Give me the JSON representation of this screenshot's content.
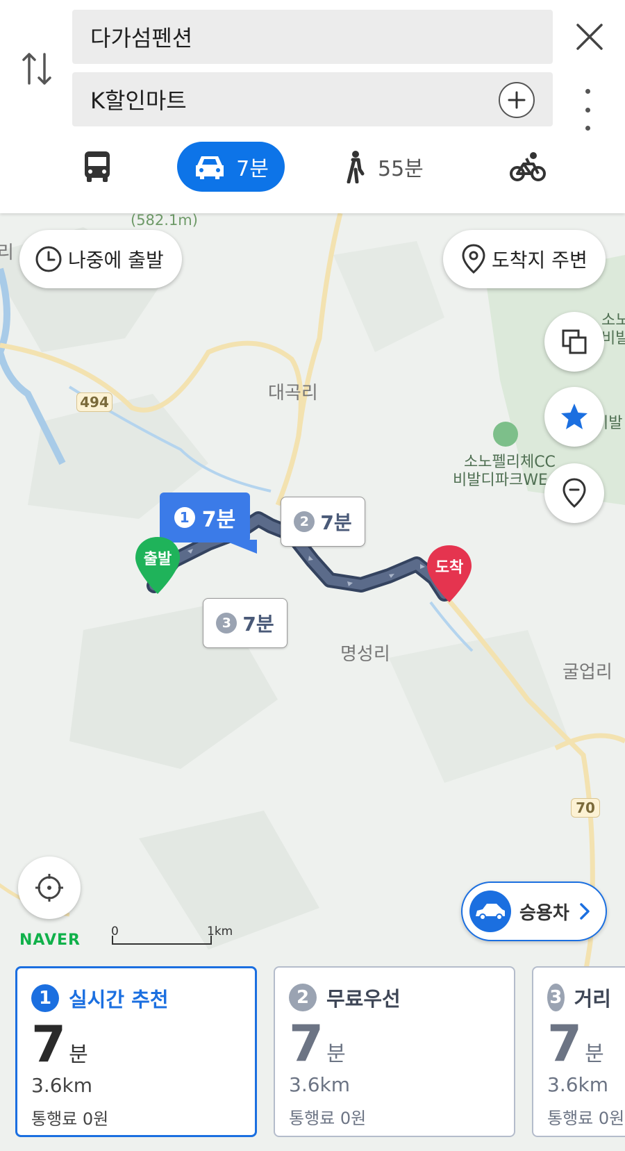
{
  "search": {
    "origin": "다가섬펜션",
    "destination": "K할인마트"
  },
  "modes": {
    "car_time": "7분",
    "walk_time": "55분"
  },
  "map": {
    "depart_later": "나중에 출발",
    "near_destination": "도착지 주변",
    "labels": {
      "elevation": "(582.1m)",
      "village1": "대곡리",
      "village2": "명성리",
      "village3": "굴업리",
      "golf": "소노펠리체CC",
      "golf2": "비발디파크WE",
      "edge_top": "소노",
      "edge_top2": "비발",
      "edge_mid": "비발",
      "left_edge": "리"
    },
    "road_tags": [
      "494",
      "70"
    ],
    "start_marker": "출발",
    "end_marker": "도착",
    "callouts": [
      {
        "num": "1",
        "time": "7분"
      },
      {
        "num": "2",
        "time": "7분"
      },
      {
        "num": "3",
        "time": "7분"
      }
    ],
    "brand": "NAVER",
    "scale": {
      "zero": "0",
      "dist": "1km"
    },
    "vehicle": "승용차"
  },
  "routes": [
    {
      "num": "1",
      "name": "실시간 추천",
      "time": "7",
      "unit": "분",
      "distance": "3.6km",
      "toll": "통행료 0원"
    },
    {
      "num": "2",
      "name": "무료우선",
      "time": "7",
      "unit": "분",
      "distance": "3.6km",
      "toll": "통행료 0원"
    },
    {
      "num": "3",
      "name": "거리",
      "time": "7",
      "unit": "분",
      "distance": "3.6km",
      "toll": "통행료 0원"
    }
  ],
  "colors": {
    "accent": "#0d74e8",
    "route": "#4c5c7c",
    "start": "#1fb35a",
    "end": "#e5344f"
  }
}
